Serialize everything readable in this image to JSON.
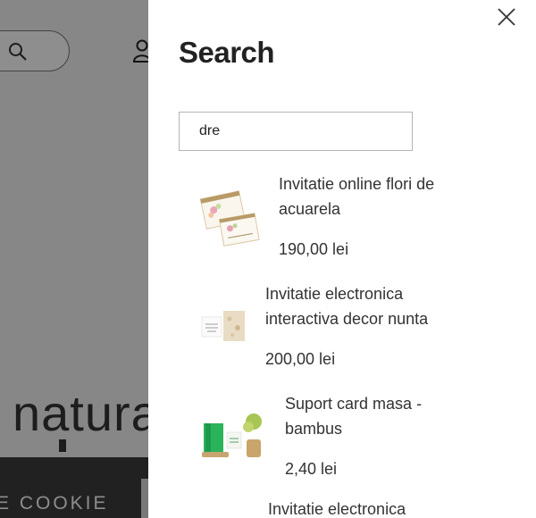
{
  "background": {
    "hero_text": "natura",
    "cookie_text": "E COOKIE"
  },
  "search_drawer": {
    "title": "Search",
    "query": "dre",
    "results": [
      {
        "title": "Invitatie online flori de acuarela",
        "price": "190,00 lei"
      },
      {
        "title": "Invitatie electronica interactiva decor nunta",
        "price": "200,00 lei"
      },
      {
        "title": "Suport card masa -bambus",
        "price": "2,40 lei"
      },
      {
        "title": "Invitatie electronica"
      }
    ]
  },
  "icons": [
    "search-icon",
    "user-icon",
    "close-icon"
  ]
}
